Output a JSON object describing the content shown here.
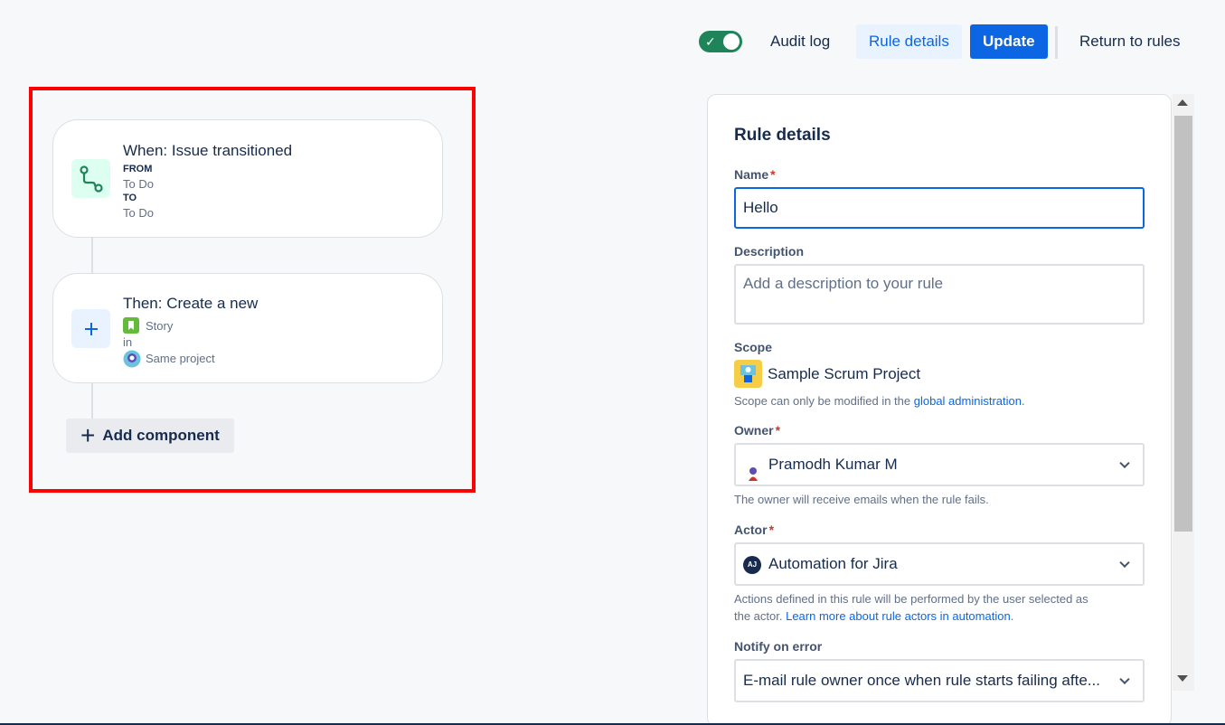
{
  "topbar": {
    "toggle_on": true,
    "audit_log": "Audit log",
    "rule_details": "Rule details",
    "update": "Update",
    "return_to_rules": "Return to rules"
  },
  "trigger": {
    "title": "When: Issue transitioned",
    "from_label": "FROM",
    "from_value": "To Do",
    "to_label": "TO",
    "to_value": "To Do",
    "icon": "transition-icon"
  },
  "action": {
    "title": "Then: Create a new",
    "issue_type": "Story",
    "in_label": "in",
    "project": "Same project",
    "icon": "plus-icon"
  },
  "add_component": "Add component",
  "panel": {
    "title": "Rule details",
    "name_label": "Name",
    "name_value": "Hello",
    "description_label": "Description",
    "description_placeholder": "Add a description to your rule",
    "scope_label": "Scope",
    "scope_value": "Sample Scrum Project",
    "scope_helper_prefix": "Scope can only be modified in the ",
    "scope_helper_link": "global administration",
    "scope_helper_suffix": ".",
    "owner_label": "Owner",
    "owner_value": "Pramodh Kumar M",
    "owner_helper": "The owner will receive emails when the rule fails.",
    "actor_label": "Actor",
    "actor_avatar": "AJ",
    "actor_value": "Automation for Jira",
    "actor_helper_line1": "Actions defined in this rule will be performed by the user selected as",
    "actor_helper_prefix": "the actor. ",
    "actor_helper_link": "Learn more about rule actors in automation",
    "actor_helper_suffix": ".",
    "notify_label": "Notify on error",
    "notify_value": "E-mail rule owner once when rule starts failing afte..."
  },
  "colors": {
    "accent": "#0c66e4",
    "toggle": "#1f845a",
    "highlight": "#ff0000"
  }
}
